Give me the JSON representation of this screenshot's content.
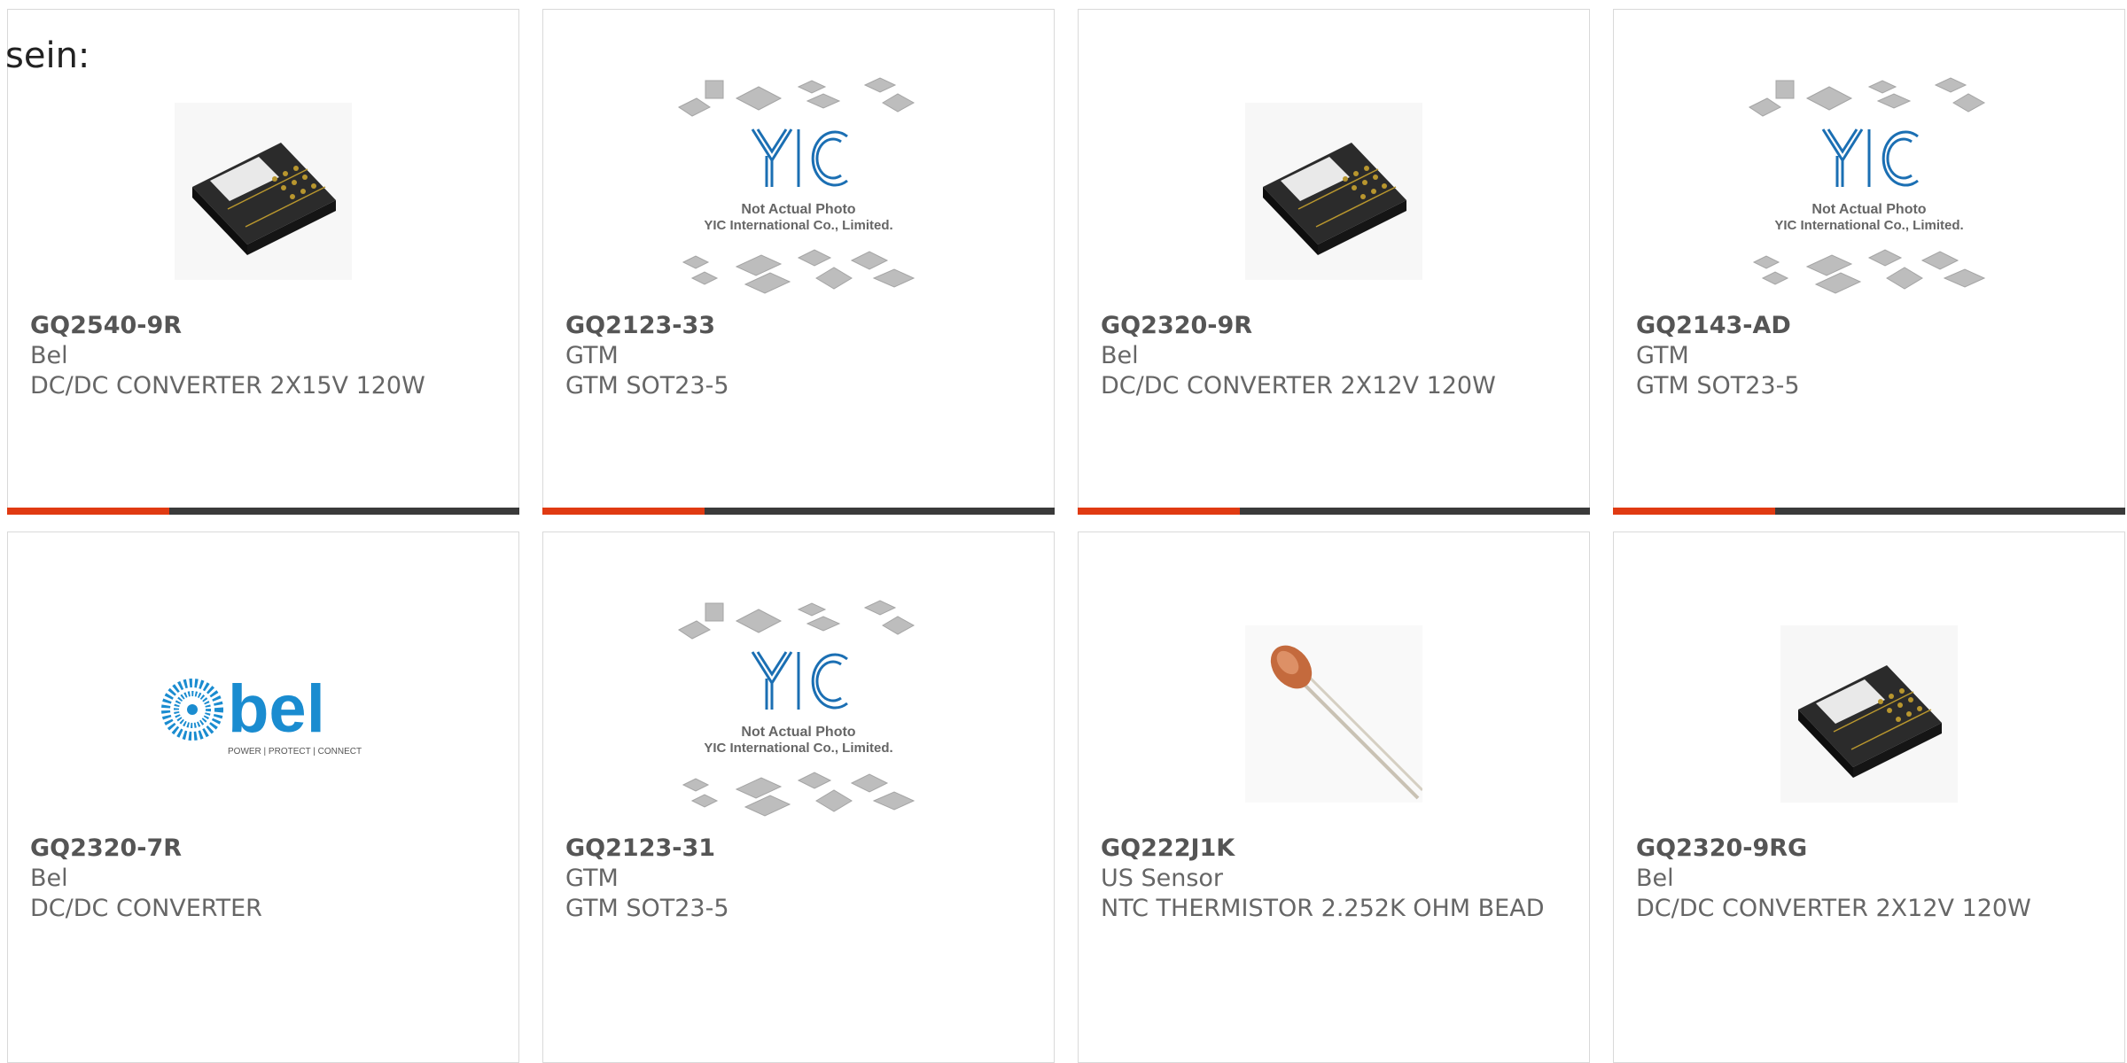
{
  "intro_text": "sein:",
  "placeholder_photo": {
    "brand": "YIC",
    "line1": "Not Actual Photo",
    "line2": "YIC International Co., Limited."
  },
  "bel_logo": {
    "brand": "bel",
    "tagline": "POWER | PROTECT | CONNECT"
  },
  "colors": {
    "accent": "#e03a12",
    "bar_dark": "#3a3a3a",
    "text": "#555555",
    "border": "#d9d9d9",
    "yic_blue": "#1b6fb3",
    "bel_blue": "#1a8cd0"
  },
  "products": [
    {
      "part": "GQ2540-9R",
      "manufacturer": "Bel",
      "description": "DC/DC CONVERTER 2X15V 120W",
      "image": "converter"
    },
    {
      "part": "GQ2123-33",
      "manufacturer": "GTM",
      "description": "GTM SOT23-5",
      "image": "yic-placeholder"
    },
    {
      "part": "GQ2320-9R",
      "manufacturer": "Bel",
      "description": "DC/DC CONVERTER 2X12V 120W",
      "image": "converter"
    },
    {
      "part": "GQ2143-AD",
      "manufacturer": "GTM",
      "description": "GTM SOT23-5",
      "image": "yic-placeholder"
    },
    {
      "part": "GQ2320-7R",
      "manufacturer": "Bel",
      "description": "DC/DC CONVERTER",
      "image": "bel-logo"
    },
    {
      "part": "GQ2123-31",
      "manufacturer": "GTM",
      "description": "GTM SOT23-5",
      "image": "yic-placeholder"
    },
    {
      "part": "GQ222J1K",
      "manufacturer": "US Sensor",
      "description": "NTC THERMISTOR 2.252K OHM BEAD",
      "image": "thermistor"
    },
    {
      "part": "GQ2320-9RG",
      "manufacturer": "Bel",
      "description": "DC/DC CONVERTER 2X12V 120W",
      "image": "converter"
    }
  ]
}
